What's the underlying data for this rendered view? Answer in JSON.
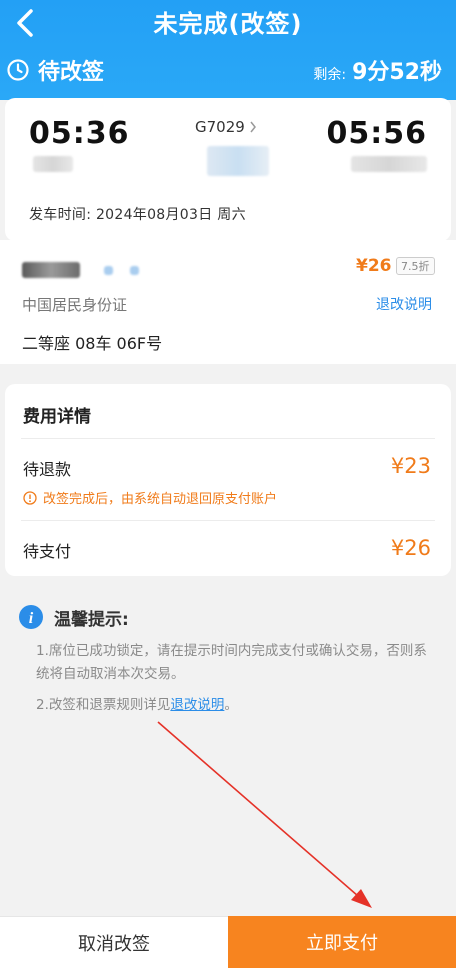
{
  "header": {
    "title": "未完成(改签)",
    "back_icon": "chevron-left-icon"
  },
  "status": {
    "label": "待改签",
    "icon": "clock-icon",
    "countdown_label": "剩余:",
    "countdown_value": "9分52秒"
  },
  "train": {
    "departure_time": "05:36",
    "arrival_time": "05:56",
    "train_number": "G7029",
    "departure_date_line": "发车时间: 2024年08月03日 周六"
  },
  "passenger": {
    "price": "¥26",
    "discount": "7.5折",
    "id_type": "中国居民身份证",
    "refund_rules_link": "退改说明",
    "seat": "二等座 08车 06F号"
  },
  "fees": {
    "title": "费用详情",
    "refund_label": "待退款",
    "refund_value": "¥23",
    "note": "改签完成后，由系统自动退回原支付账户",
    "pay_label": "待支付",
    "pay_value": "¥26"
  },
  "tips": {
    "title": "温馨提示:",
    "line1": "1.席位已成功锁定，请在提示时间内完成支付或确认交易，否则系统将自动取消本次交易。",
    "line2_prefix": "2.改签和退票规则详见",
    "line2_link": "退改说明",
    "line2_suffix": "。"
  },
  "actions": {
    "cancel": "取消改签",
    "pay": "立即支付"
  },
  "colors": {
    "header_blue": "#23a0f5",
    "accent_orange": "#f07b1a",
    "pay_button": "#f7841f",
    "link_blue": "#2b8de8",
    "annotation_red": "#e53228"
  }
}
